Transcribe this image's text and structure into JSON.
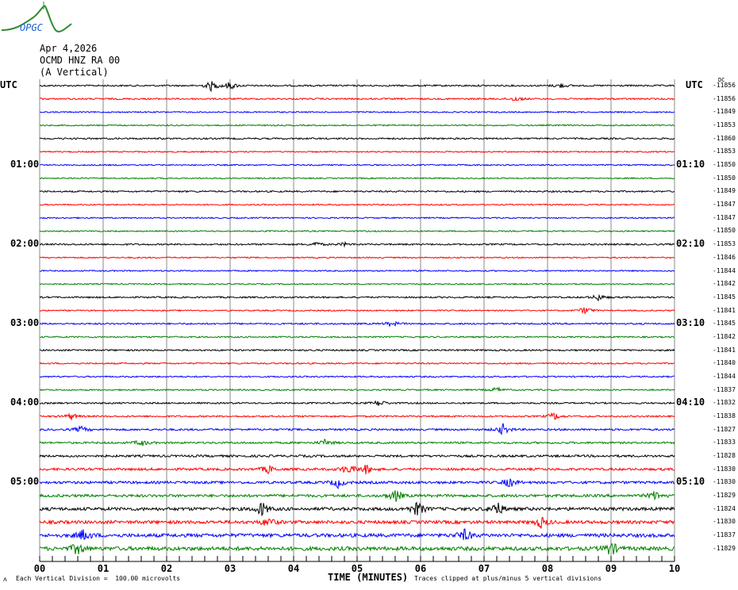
{
  "logo": {
    "text": "OPGC"
  },
  "header": {
    "date": "Apr 4,2026",
    "station": "OCMD HNZ RA 00",
    "component": "(A Vertical)"
  },
  "left_utc": "UTC",
  "right_utc": "UTC",
  "dc_label": "DC",
  "left_hour_labels": [
    {
      "trace": 6,
      "text": "01:00"
    },
    {
      "trace": 12,
      "text": "02:00"
    },
    {
      "trace": 18,
      "text": "03:00"
    },
    {
      "trace": 24,
      "text": "04:00"
    },
    {
      "trace": 30,
      "text": "05:00"
    }
  ],
  "right_hour_labels": [
    {
      "trace": 6,
      "text": "01:10"
    },
    {
      "trace": 12,
      "text": "02:10"
    },
    {
      "trace": 18,
      "text": "03:10"
    },
    {
      "trace": 24,
      "text": "04:10"
    },
    {
      "trace": 30,
      "text": "05:10"
    }
  ],
  "footer": {
    "scale_note": "Each Vertical Division =  100.00 microvolts",
    "xlabel": "TIME (MINUTES)",
    "clip_note": "Traces clipped at plus/minus 5 vertical divisions",
    "corner_mark": "ʌ"
  },
  "chart_data": {
    "type": "line",
    "title": "OCMD HNZ RA 00 helicorder, Apr 4,2026",
    "xlabel": "TIME (MINUTES)",
    "xlim": [
      0,
      10
    ],
    "x_ticks": [
      "00",
      "01",
      "02",
      "03",
      "04",
      "05",
      "06",
      "07",
      "08",
      "09",
      "10"
    ],
    "minutes_per_trace": 10,
    "trace_colors": [
      "#000000",
      "#ff0000",
      "#0000ff",
      "#008000"
    ],
    "dc_offsets": [
      -11856,
      -11856,
      -11849,
      -11853,
      -11860,
      -11853,
      -11850,
      -11850,
      -11849,
      -11847,
      -11847,
      -11850,
      -11853,
      -11846,
      -11844,
      -11842,
      -11845,
      -11841,
      -11845,
      -11842,
      -11841,
      -11840,
      -11844,
      -11837,
      -11832,
      -11838,
      -11827,
      -11833,
      -11828,
      -11830,
      -11830,
      -11829,
      -11824,
      -11830,
      -11837,
      -11829
    ],
    "noise_levels": [
      1,
      1,
      0.8,
      0.8,
      1,
      0.8,
      0.8,
      0.8,
      1,
      0.8,
      0.8,
      0.8,
      1,
      0.8,
      0.8,
      0.8,
      1,
      0.8,
      1,
      0.9,
      1,
      0.9,
      0.9,
      0.9,
      1,
      1,
      1.2,
      1.2,
      1.4,
      1.5,
      1.6,
      1.7,
      2,
      2,
      2.2,
      2.4
    ],
    "events": [
      {
        "trace": 0,
        "minute": 2.7,
        "amp": 6
      },
      {
        "trace": 0,
        "minute": 3.0,
        "amp": 5
      },
      {
        "trace": 0,
        "minute": 8.2,
        "amp": 3
      },
      {
        "trace": 1,
        "minute": 7.5,
        "amp": 3
      },
      {
        "trace": 12,
        "minute": 4.35,
        "amp": 3
      },
      {
        "trace": 12,
        "minute": 4.8,
        "amp": 2
      },
      {
        "trace": 16,
        "minute": 8.8,
        "amp": 4
      },
      {
        "trace": 17,
        "minute": 8.6,
        "amp": 5
      },
      {
        "trace": 18,
        "minute": 5.55,
        "amp": 4
      },
      {
        "trace": 23,
        "minute": 7.2,
        "amp": 3
      },
      {
        "trace": 24,
        "minute": 5.35,
        "amp": 4
      },
      {
        "trace": 25,
        "minute": 0.5,
        "amp": 4
      },
      {
        "trace": 25,
        "minute": 8.1,
        "amp": 5
      },
      {
        "trace": 26,
        "minute": 0.65,
        "amp": 4
      },
      {
        "trace": 26,
        "minute": 7.3,
        "amp": 7
      },
      {
        "trace": 27,
        "minute": 1.6,
        "amp": 4
      },
      {
        "trace": 27,
        "minute": 4.5,
        "amp": 4
      },
      {
        "trace": 29,
        "minute": 3.6,
        "amp": 5
      },
      {
        "trace": 29,
        "minute": 4.85,
        "amp": 6
      },
      {
        "trace": 29,
        "minute": 5.15,
        "amp": 6
      },
      {
        "trace": 30,
        "minute": 4.7,
        "amp": 6
      },
      {
        "trace": 30,
        "minute": 7.4,
        "amp": 6
      },
      {
        "trace": 31,
        "minute": 5.6,
        "amp": 8
      },
      {
        "trace": 31,
        "minute": 9.7,
        "amp": 6
      },
      {
        "trace": 32,
        "minute": 3.5,
        "amp": 9
      },
      {
        "trace": 32,
        "minute": 5.95,
        "amp": 10
      },
      {
        "trace": 32,
        "minute": 7.2,
        "amp": 10
      },
      {
        "trace": 33,
        "minute": 3.6,
        "amp": 6
      },
      {
        "trace": 33,
        "minute": 7.9,
        "amp": 7
      },
      {
        "trace": 34,
        "minute": 0.7,
        "amp": 8
      },
      {
        "trace": 34,
        "minute": 6.7,
        "amp": 8
      },
      {
        "trace": 35,
        "minute": 0.6,
        "amp": 8
      },
      {
        "trace": 35,
        "minute": 9.0,
        "amp": 9
      }
    ]
  }
}
